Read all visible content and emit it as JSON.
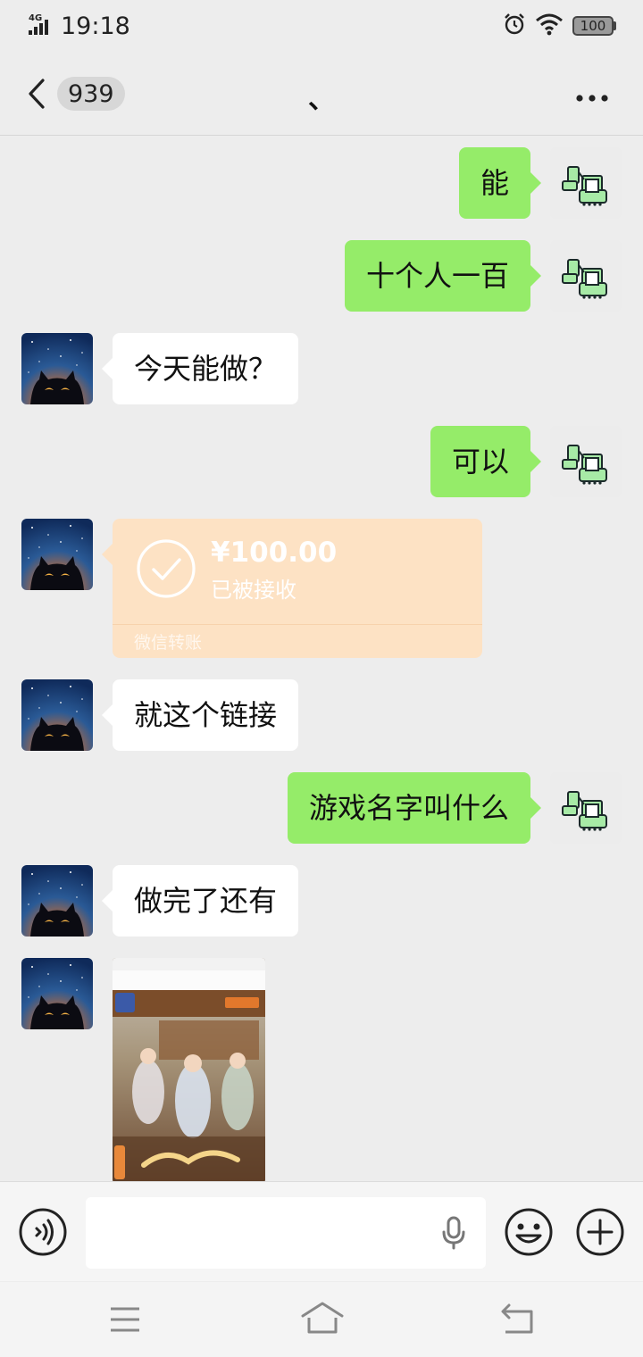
{
  "status_bar": {
    "network": "4G",
    "time": "19:18",
    "battery": "100",
    "icons": [
      "signal-icon",
      "alarm-icon",
      "wifi-icon",
      "battery-icon"
    ]
  },
  "header": {
    "unread_count": "939",
    "title": "、",
    "icons": [
      "back-arrow-icon",
      "more-dots-icon"
    ]
  },
  "messages": [
    {
      "side": "right",
      "type": "text",
      "text": "能"
    },
    {
      "side": "right",
      "type": "text",
      "text": "十个人一百"
    },
    {
      "side": "left",
      "type": "text",
      "text": "今天能做？"
    },
    {
      "side": "right",
      "type": "text",
      "text": "可以"
    },
    {
      "side": "left",
      "type": "transfer",
      "amount": "¥100.00",
      "status": "已被接收",
      "footer": "微信转账"
    },
    {
      "side": "left",
      "type": "text",
      "text": "就这个链接"
    },
    {
      "side": "right",
      "type": "text",
      "text": "游戏名字叫什么"
    },
    {
      "side": "left",
      "type": "text",
      "text": "做完了还有"
    },
    {
      "side": "left",
      "type": "image",
      "image_name": "game-screenshot"
    }
  ],
  "input_bar": {
    "value": "",
    "icons": [
      "voice-icon",
      "mic-icon",
      "emoji-icon",
      "plus-icon"
    ]
  },
  "nav_bar": {
    "icons": [
      "menu-icon",
      "home-icon",
      "back-icon"
    ]
  },
  "colors": {
    "background": "#ededed",
    "sent_bubble": "#95ec69",
    "received_bubble": "#ffffff",
    "transfer_bubble": "#fde2c4"
  }
}
